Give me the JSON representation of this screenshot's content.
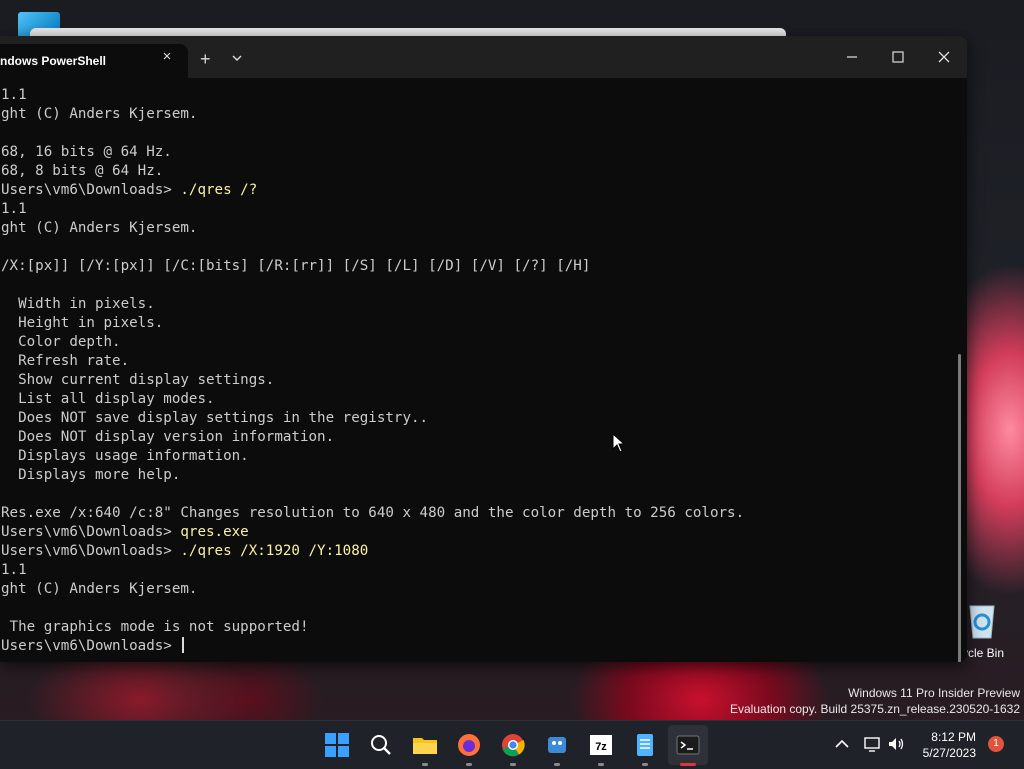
{
  "window": {
    "tab_title": "ndows PowerShell",
    "new_tab_symbol": "+",
    "close_symbol": "×"
  },
  "terminal": {
    "lines": [
      {
        "text": "1.1",
        "cmd": ""
      },
      {
        "text": "ght (C) Anders Kjersem.",
        "cmd": ""
      },
      {
        "text": "",
        "cmd": ""
      },
      {
        "text": "68, 16 bits @ 64 Hz.",
        "cmd": ""
      },
      {
        "text": "68, 8 bits @ 64 Hz.",
        "cmd": ""
      },
      {
        "text": "Users\\vm6\\Downloads> ",
        "cmd": "./qres /?"
      },
      {
        "text": "1.1",
        "cmd": ""
      },
      {
        "text": "ght (C) Anders Kjersem.",
        "cmd": ""
      },
      {
        "text": "",
        "cmd": ""
      },
      {
        "text": "/X:[px]] [/Y:[px]] [/C:[bits] [/R:[rr]] [/S] [/L] [/D] [/V] [/?] [/H]",
        "cmd": ""
      },
      {
        "text": "",
        "cmd": ""
      },
      {
        "text": "  Width in pixels.",
        "cmd": ""
      },
      {
        "text": "  Height in pixels.",
        "cmd": ""
      },
      {
        "text": "  Color depth.",
        "cmd": ""
      },
      {
        "text": "  Refresh rate.",
        "cmd": ""
      },
      {
        "text": "  Show current display settings.",
        "cmd": ""
      },
      {
        "text": "  List all display modes.",
        "cmd": ""
      },
      {
        "text": "  Does NOT save display settings in the registry..",
        "cmd": ""
      },
      {
        "text": "  Does NOT display version information.",
        "cmd": ""
      },
      {
        "text": "  Displays usage information.",
        "cmd": ""
      },
      {
        "text": "  Displays more help.",
        "cmd": ""
      },
      {
        "text": "",
        "cmd": ""
      },
      {
        "text": "Res.exe /x:640 /c:8\" Changes resolution to 640 x 480 and the color depth to 256 colors.",
        "cmd": ""
      },
      {
        "text": "Users\\vm6\\Downloads> ",
        "cmd": "qres.exe"
      },
      {
        "text": "Users\\vm6\\Downloads> ",
        "cmd": "./qres /X:1920 /Y:1080"
      },
      {
        "text": "1.1",
        "cmd": ""
      },
      {
        "text": "ght (C) Anders Kjersem.",
        "cmd": ""
      },
      {
        "text": "",
        "cmd": ""
      },
      {
        "text": " The graphics mode is not supported!",
        "cmd": ""
      },
      {
        "text": "Users\\vm6\\Downloads> ",
        "cmd": ""
      }
    ]
  },
  "desktop": {
    "recycle_bin_label": "ycle Bin",
    "watermark_line1": "Windows 11 Pro Insider Preview",
    "watermark_line2": "Evaluation copy. Build 25375.zn_release.230520-1632"
  },
  "taskbar": {
    "time": "8:12 PM",
    "date": "5/27/2023",
    "notification_count": "1",
    "icons": [
      "windows-start-icon",
      "search-icon",
      "file-explorer-icon",
      "firefox-icon",
      "chrome-icon",
      "app-icon",
      "7zip-icon",
      "notepad-icon",
      "terminal-icon"
    ]
  },
  "colors": {
    "terminal_bg": "#0c0c0c",
    "command_text": "#f9f1a5",
    "output_text": "#cccccc",
    "active_indicator": "#d8373b"
  }
}
